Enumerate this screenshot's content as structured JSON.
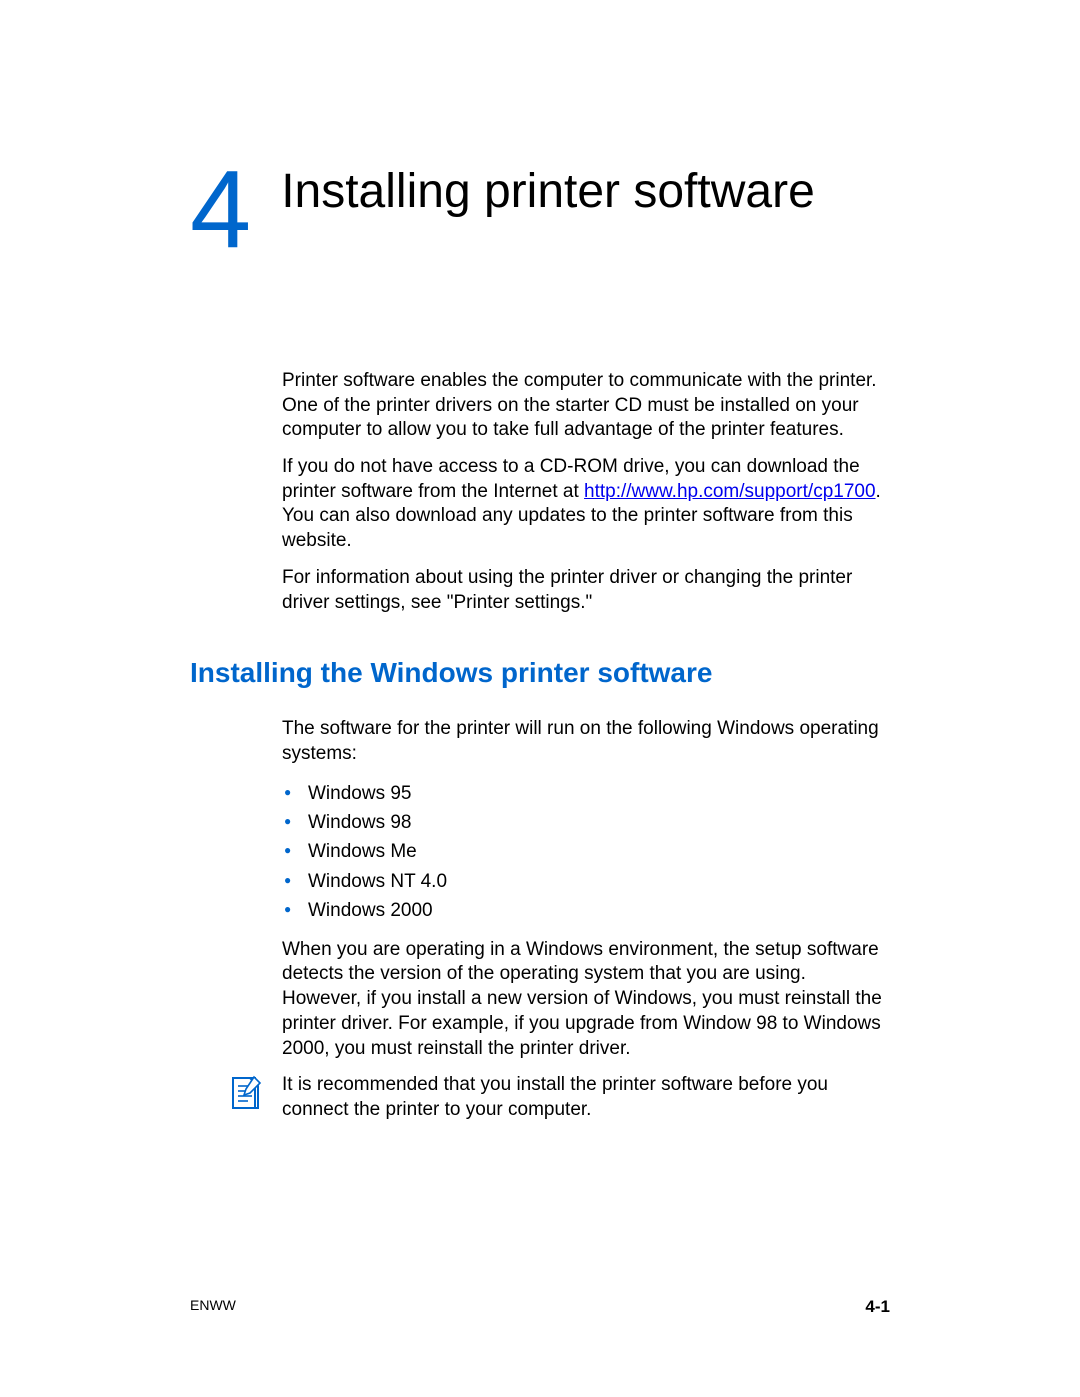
{
  "chapter": {
    "number": "4",
    "title": "Installing printer software"
  },
  "intro": {
    "p1": "Printer software enables the computer to communicate with the printer. One of the printer drivers on the starter CD must be installed on your computer to allow you to take full advantage of the printer features.",
    "p2_pre": "If you do not have access to a CD-ROM drive, you can download the printer software from the Internet at ",
    "p2_link": "http://www.hp.com/support/cp1700",
    "p2_post": ". You can also download any updates to the printer software from this website.",
    "p3": "For information about using the printer driver or changing the printer driver settings, see \"Printer settings.\""
  },
  "section": {
    "heading": "Installing the Windows printer software",
    "p1": "The software for the printer will run on the following Windows operating systems:",
    "bullets": [
      "Windows 95",
      "Windows 98",
      "Windows Me",
      "Windows NT 4.0",
      "Windows 2000"
    ],
    "p2": "When you are operating in a Windows environment, the setup software detects the version of the operating system that you are using. However, if you install a new version of Windows, you must reinstall the printer driver. For example, if you upgrade from Window 98 to Windows 2000, you must reinstall the printer driver.",
    "note": "It is recommended that you install the printer software before you connect the printer to your computer."
  },
  "footer": {
    "left": "ENWW",
    "right": "4-1"
  }
}
